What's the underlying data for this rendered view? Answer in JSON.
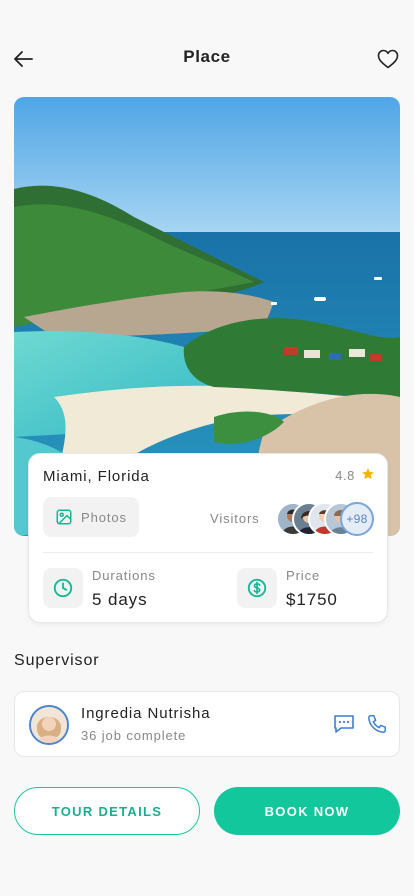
{
  "header": {
    "title": "Place",
    "back_icon": "arrow-left-icon",
    "favorite_icon": "heart-outline-icon"
  },
  "place": {
    "name": "Miami, Florida",
    "rating": "4.8",
    "rating_icon": "star-icon",
    "photos_label": "Photos",
    "visitors_label": "Visitors",
    "visitors_more": "+98",
    "duration_label": "Durations",
    "duration_value": "5 days",
    "price_label": "Price",
    "price_value": "$1750"
  },
  "supervisor": {
    "section_title": "Supervisor",
    "name": "Ingredia Nutrisha",
    "jobs": "36 job complete"
  },
  "actions": {
    "tour_details": "TOUR DETAILS",
    "book_now": "BOOK NOW"
  },
  "colors": {
    "accent": "#12c79c",
    "accent_text": "#1aae92",
    "link_blue": "#3d7fd1",
    "star": "#f3b400",
    "background": "#f8f8f8"
  }
}
